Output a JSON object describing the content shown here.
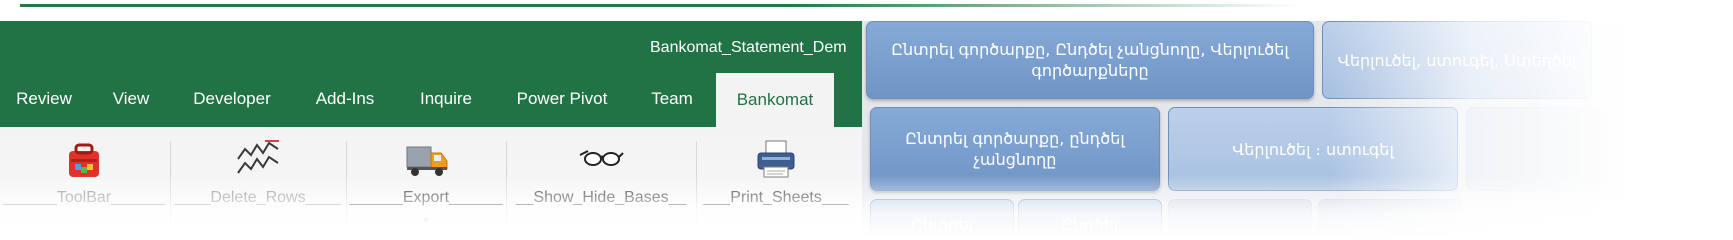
{
  "window": {
    "title": "Bankomat_Statement_Dem"
  },
  "tabs": [
    "Review",
    "View",
    "Developer",
    "Add-Ins",
    "Inquire",
    "Power Pivot",
    "Team",
    "Bankomat"
  ],
  "active_tab": "Bankomat",
  "ribbon_groups": [
    {
      "label": "______ToolBar______",
      "icon": "toolbox-icon"
    },
    {
      "label": "____Delete_Rows____",
      "icon": "delete-rows-icon"
    },
    {
      "label": "______Export______",
      "icon": "truck-icon"
    },
    {
      "label": "__Show_Hide_Bases__",
      "icon": "glasses-icon"
    },
    {
      "label": "___Print_Sheets___",
      "icon": "printer-icon"
    }
  ],
  "menu": {
    "row1": [
      "Ընտրել գործարքը, Ընդծել չանցնողը, Վերլուծել գործարքները",
      "Վերլուծել, ստուգել, Ստեղծել"
    ],
    "row2": [
      "Ընտրել գործարքը, ընդծել չանցնողը",
      "Վերլուծել ։ ստուգել"
    ],
    "row3": [
      "Ընտրել",
      "Ընդծել"
    ]
  },
  "colors": {
    "excel_green": "#217346",
    "button_blue": "#7da1d0"
  }
}
